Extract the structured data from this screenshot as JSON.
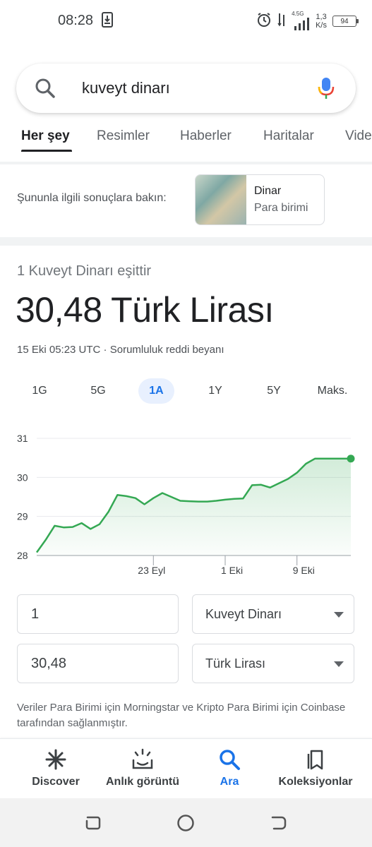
{
  "status_bar": {
    "time": "08:28",
    "network": "4.5G",
    "speed_value": "1,3",
    "speed_unit": "K/s",
    "battery": "94"
  },
  "search": {
    "query": "kuveyt dinarı"
  },
  "tabs": [
    {
      "label": "Her şey",
      "active": true
    },
    {
      "label": "Resimler",
      "active": false
    },
    {
      "label": "Haberler",
      "active": false
    },
    {
      "label": "Haritalar",
      "active": false
    },
    {
      "label": "Vide",
      "active": false
    }
  ],
  "related": {
    "label": "Şununla ilgili sonuçlara bakın:",
    "card_title": "Dinar",
    "card_subtitle": "Para birimi"
  },
  "converter": {
    "equals_label": "1 Kuveyt Dinarı eşittir",
    "result": "30,48 Türk Lirası",
    "timestamp": "15 Eki 05:23 UTC",
    "separator": " · ",
    "disclaimer": "Sorumluluk reddi beyanı",
    "ranges": [
      "1G",
      "5G",
      "1A",
      "1Y",
      "5Y",
      "Maks."
    ],
    "active_range": "1A",
    "from_amount": "1",
    "from_currency": "Kuveyt Dinarı",
    "to_amount": "30,48",
    "to_currency": "Türk Lirası",
    "source_note": "Veriler Para Birimi için Morningstar ve Kripto Para Birimi için Coinbase tarafından sağlanmıştır."
  },
  "chart_data": {
    "type": "area",
    "title": "",
    "xlabel": "",
    "ylabel": "",
    "ylim": [
      28,
      31
    ],
    "y_ticks": [
      28,
      29,
      30,
      31
    ],
    "x_tick_labels": [
      "23 Eyl",
      "1 Eki",
      "9 Eki"
    ],
    "x_tick_positions": [
      13,
      21,
      29
    ],
    "x_range": [
      0,
      35
    ],
    "series": [
      {
        "x": [
          0,
          1,
          2,
          3,
          4,
          5,
          6,
          7,
          8,
          9,
          10,
          11,
          12,
          13,
          14,
          15,
          16,
          17,
          18,
          19,
          20,
          21,
          22,
          23,
          24,
          25,
          26,
          27,
          28,
          29,
          30,
          31,
          32,
          33,
          34,
          35
        ],
        "values": [
          28.08,
          28.4,
          28.76,
          28.72,
          28.73,
          28.83,
          28.68,
          28.8,
          29.12,
          29.55,
          29.52,
          29.47,
          29.31,
          29.47,
          29.6,
          29.5,
          29.4,
          29.39,
          29.38,
          29.38,
          29.4,
          29.43,
          29.45,
          29.46,
          29.8,
          29.81,
          29.74,
          29.85,
          29.96,
          30.12,
          30.35,
          30.48,
          30.48,
          30.48,
          30.48,
          30.48
        ]
      }
    ],
    "grid": true,
    "color": "#34a853",
    "fill_color": "#e6f4ea"
  },
  "bottom_nav": [
    {
      "label": "Discover",
      "icon": "asterisk-icon",
      "active": false
    },
    {
      "label": "Anlık görüntü",
      "icon": "snapshot-icon",
      "active": false
    },
    {
      "label": "Ara",
      "icon": "search-icon",
      "active": true
    },
    {
      "label": "Koleksiyonlar",
      "icon": "collections-icon",
      "active": false
    }
  ],
  "colors": {
    "accent": "#1a73e8",
    "chart_line": "#34a853"
  }
}
